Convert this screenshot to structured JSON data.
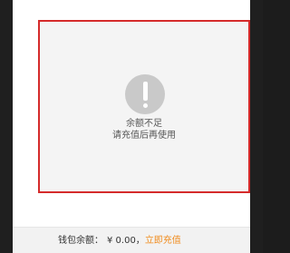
{
  "dialog": {
    "alert": {
      "icon": "exclamation-icon",
      "line1": "余额不足",
      "line2": "请充值后再使用"
    }
  },
  "footer": {
    "wallet_label": "钱包余额：",
    "wallet_amount": "¥ 0.00，",
    "recharge_link": "立即充值"
  },
  "colors": {
    "highlight_border": "#d52b2b",
    "link_orange": "#f08c1e"
  }
}
